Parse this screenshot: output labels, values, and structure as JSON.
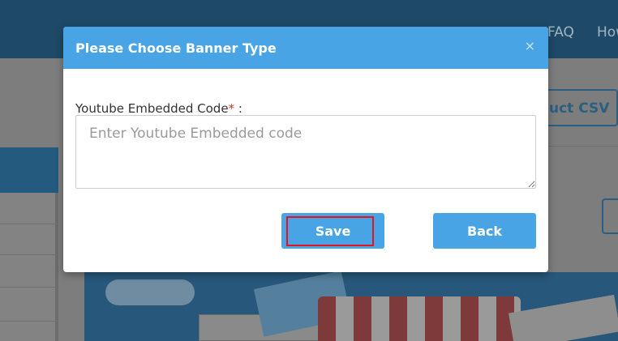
{
  "background": {
    "nav_items": [
      "FAQ",
      "How"
    ],
    "csv_button_label": "uct CSV"
  },
  "modal": {
    "title": "Please Choose Banner Type",
    "close_label": "×",
    "field": {
      "label": "Youtube Embedded Code",
      "required_mark": "*",
      "label_suffix": " :",
      "value": "",
      "placeholder": "Enter Youtube Embedded code"
    },
    "save_label": "Save",
    "back_label": "Back"
  },
  "colors": {
    "modal_header": "#48a4e4",
    "button": "#48a4e4",
    "highlight": "#e2141e",
    "required": "#c0392b"
  }
}
